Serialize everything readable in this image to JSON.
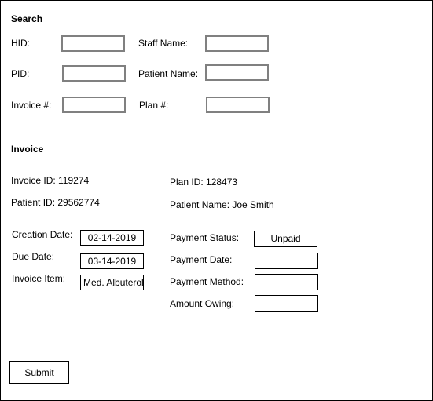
{
  "search": {
    "title": "Search",
    "hid_label": "HID:",
    "hid_value": "",
    "staff_name_label": "Staff Name:",
    "staff_name_value": "",
    "pid_label": "PID:",
    "pid_value": "",
    "patient_name_label": "Patient Name:",
    "patient_name_value": "",
    "invoice_no_label": "Invoice #:",
    "invoice_no_value": "",
    "plan_no_label": "Plan #:",
    "plan_no_value": ""
  },
  "invoice": {
    "title": "Invoice",
    "invoice_id": "Invoice ID: 119274",
    "plan_id": "Plan ID: 128473",
    "patient_id": "Patient ID: 29562774",
    "patient_name": "Patient Name: Joe Smith",
    "creation_date_label": "Creation Date:",
    "creation_date_value": "02-14-2019",
    "due_date_label": "Due Date:",
    "due_date_value": "03-14-2019",
    "invoice_item_label": "Invoice Item:",
    "invoice_item_value": "Med. Albuterol",
    "payment_status_label": "Payment Status:",
    "payment_status_value": "Unpaid",
    "payment_date_label": "Payment Date:",
    "payment_date_value": "",
    "payment_method_label": "Payment Method:",
    "payment_method_value": "",
    "amount_owing_label": "Amount Owing:",
    "amount_owing_value": ""
  },
  "actions": {
    "submit_label": "Submit"
  }
}
